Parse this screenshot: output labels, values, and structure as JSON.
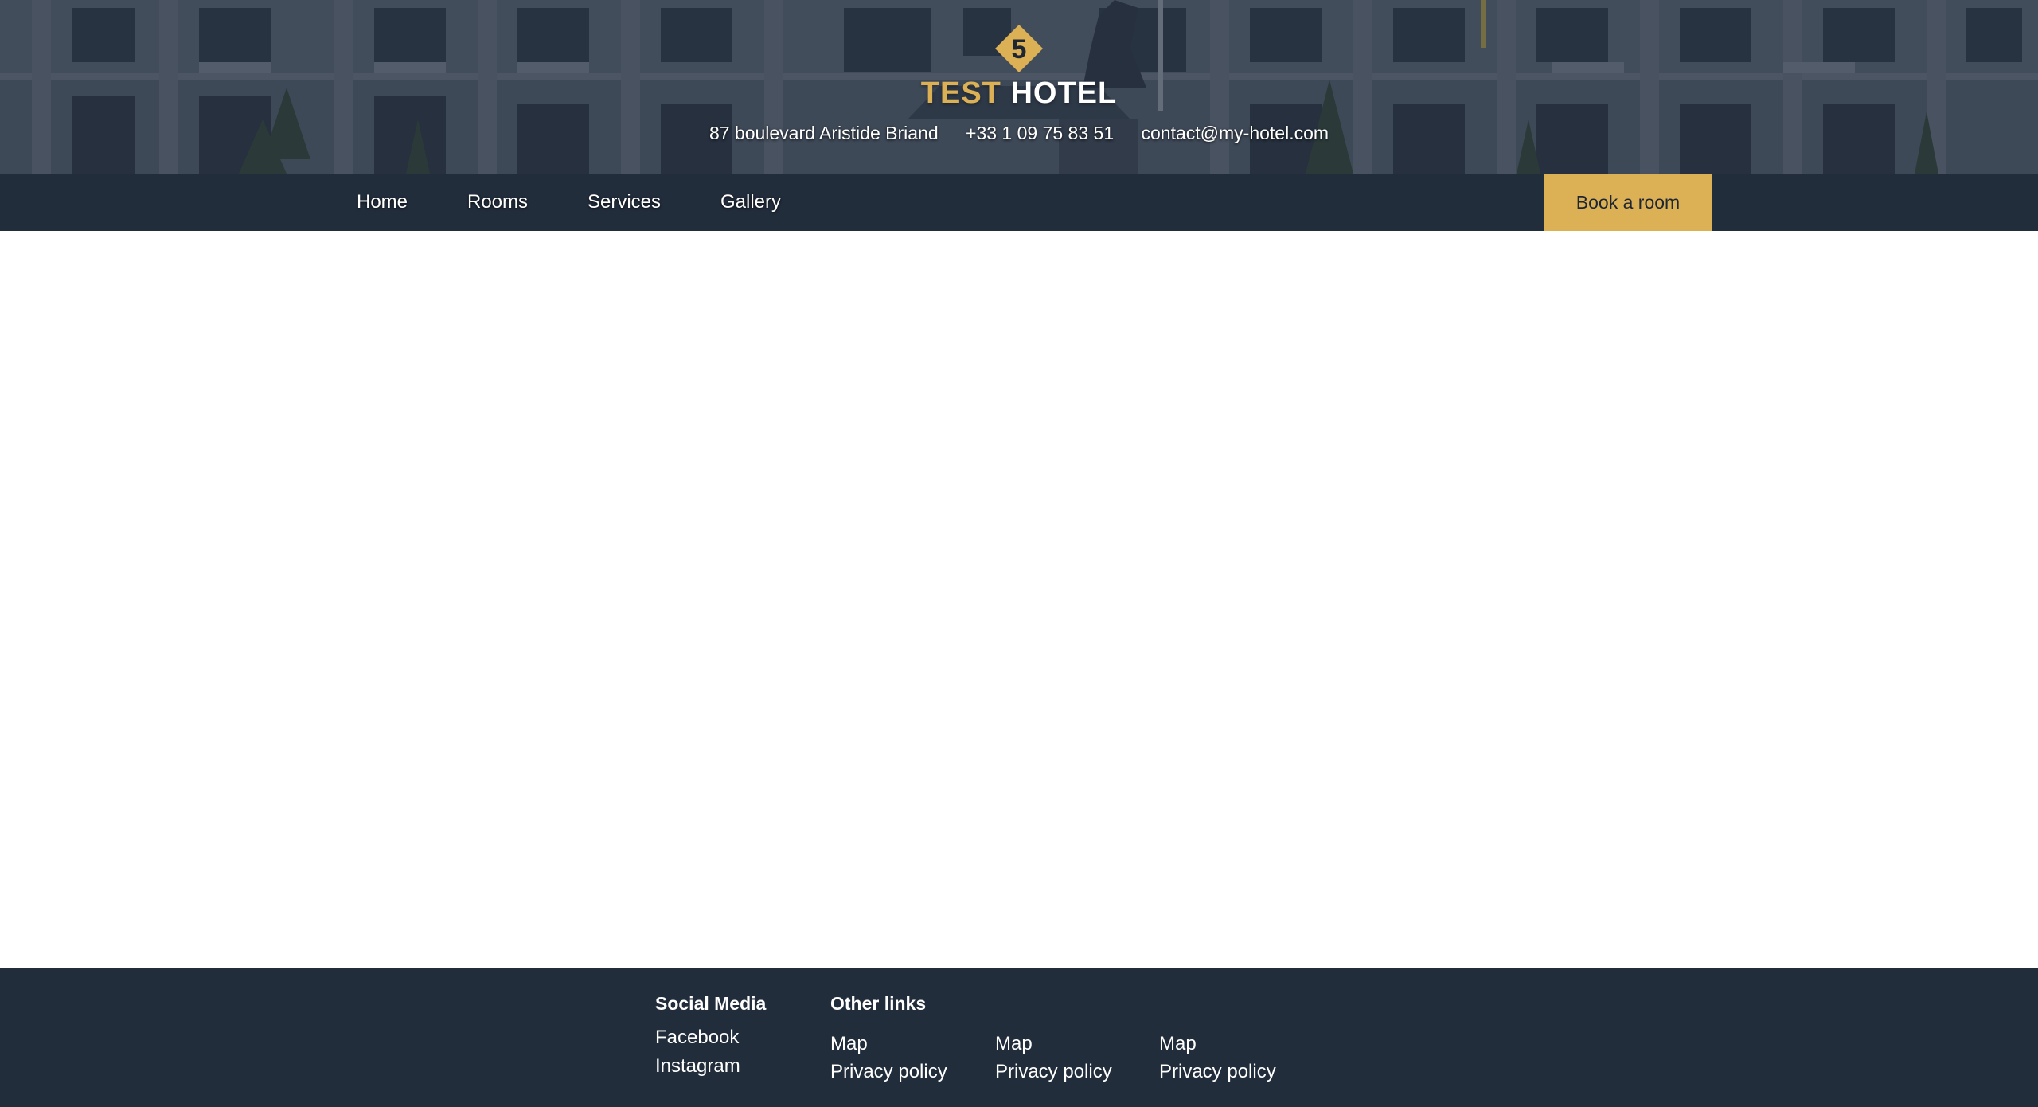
{
  "brand": {
    "logo_icon": "diamond-five-icon",
    "logo_number": "5",
    "name_part1": "TEST",
    "name_part2": "HOTEL",
    "accent_color": "#dcb055",
    "dark_color": "#222d3c"
  },
  "contact": {
    "address": "87 boulevard Aristide Briand",
    "phone": "+33 1 09 75 83 51",
    "email": "contact@my-hotel.com"
  },
  "nav": {
    "items": [
      {
        "label": "Home"
      },
      {
        "label": "Rooms"
      },
      {
        "label": "Services"
      },
      {
        "label": "Gallery"
      }
    ],
    "book_label": "Book a room"
  },
  "footer": {
    "social": {
      "heading": "Social Media",
      "links": [
        "Facebook",
        "Instagram"
      ]
    },
    "other": {
      "heading": "Other links",
      "columns": [
        [
          "Map",
          "Privacy policy"
        ],
        [
          "Map",
          "Privacy policy"
        ],
        [
          "Map",
          "Privacy policy"
        ]
      ]
    }
  }
}
